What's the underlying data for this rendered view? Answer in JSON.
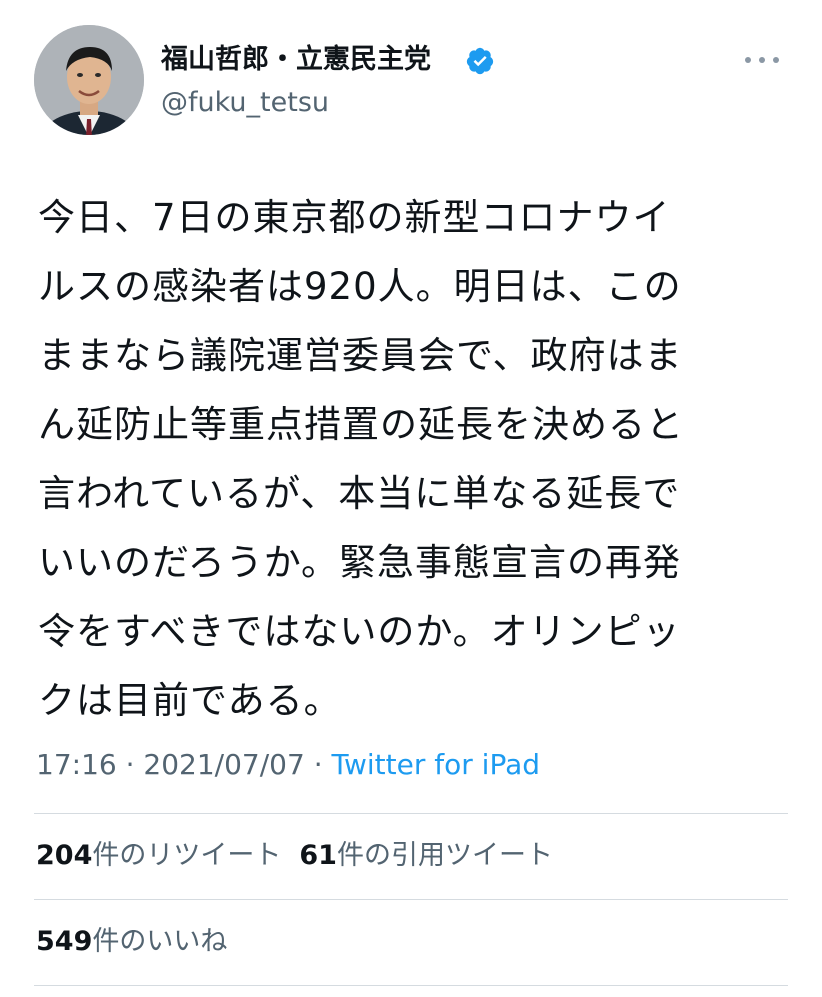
{
  "author": {
    "display_name": "福山哲郎・立憲民主党",
    "handle": "@fuku_tetsu",
    "verified": true,
    "verified_icon": "verified-badge-icon",
    "avatar_icon": "profile-photo"
  },
  "tweet": {
    "text": "今日、7日の東京都の新型コロナウイ\nルスの感染者は920人。明日は、この\nままなら議院運営委員会で、政府はま\nん延防止等重点措置の延長を決めると\n言われているが、本当に単なる延長で\nいいのだろうか。緊急事態宣言の再発\n令をすべきではないのか。オリンピッ\nクは目前である。",
    "time": "17:16",
    "separator": "·",
    "date": "2021/07/07",
    "source": "Twitter for iPad"
  },
  "stats": {
    "retweets_count": "204",
    "retweets_label": "件のリツイート",
    "quotes_count": "61",
    "quotes_label": "件の引用ツイート",
    "likes_count": "549",
    "likes_label": "件のいいね"
  },
  "colors": {
    "accent": "#1d9bf0",
    "text": "#0f1419",
    "secondary": "#536471",
    "divider": "#d5dbe0"
  }
}
